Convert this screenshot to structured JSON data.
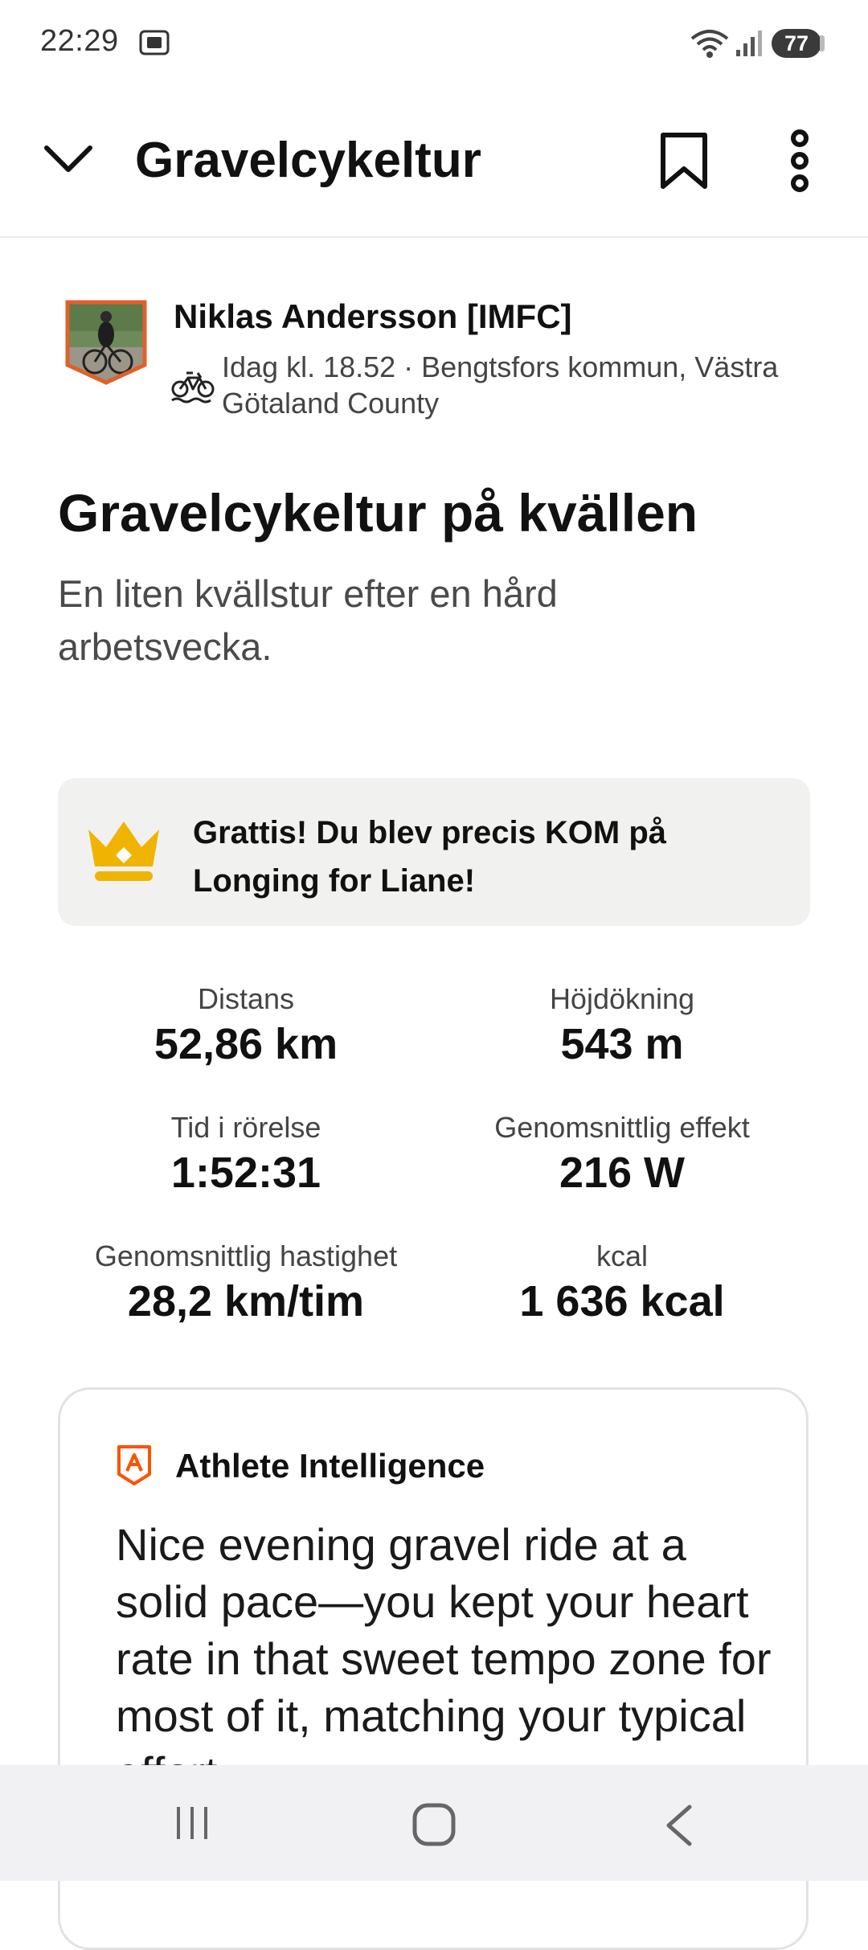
{
  "status_bar": {
    "time": "22:29",
    "battery": "77",
    "icons": [
      "screenshot-icon",
      "wifi-icon",
      "signal-icon",
      "battery-icon"
    ]
  },
  "app_bar": {
    "title": "Gravelcykeltur",
    "icons": [
      "chevron-down-icon",
      "bookmark-icon",
      "more-vertical-icon"
    ]
  },
  "athlete": {
    "name": "Niklas Andersson [IMFC]",
    "meta": "Idag kl. 18.52 · Bengtsfors kommun, Västra Götaland County",
    "sport_icon": "bike-icon"
  },
  "activity": {
    "title": "Gravelcykeltur på kvällen",
    "description": "En liten kvällstur efter en hård arbetsvecka."
  },
  "achievement": {
    "icon": "crown-icon",
    "text": "Grattis! Du blev precis KOM på Longing for Liane!"
  },
  "stats": [
    {
      "label": "Distans",
      "value": "52,86 km"
    },
    {
      "label": "Höjdökning",
      "value": "543 m"
    },
    {
      "label": "Tid i rörelse",
      "value": "1:52:31"
    },
    {
      "label": "Genomsnittlig effekt",
      "value": "216 W"
    },
    {
      "label": "Genomsnittlig hastighet",
      "value": "28,2 km/tim"
    },
    {
      "label": "kcal",
      "value": "1 636 kcal"
    }
  ],
  "athlete_intelligence": {
    "title": "Athlete Intelligence",
    "text": "Nice evening gravel ride at a solid pace—you kept your heart rate in that sweet tempo zone for most of it, matching your typical effort"
  },
  "colors": {
    "accent": "#fc5200",
    "crown": "#f0b400",
    "banner_bg": "#f1f1ef"
  }
}
